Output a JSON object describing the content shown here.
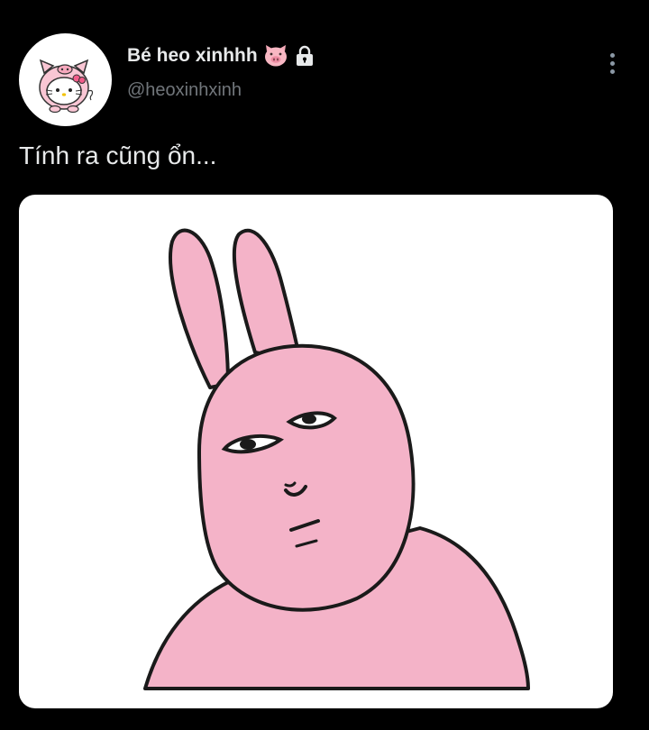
{
  "tweet": {
    "display_name": "Bé heo xinhhh",
    "handle": "@heoxinhxinh",
    "text": "Tính ra cũng ổn...",
    "badges": [
      "pig-face-emoji",
      "lock-icon"
    ]
  },
  "media": {
    "icon": "pink-rabbit-meme-image"
  },
  "colors": {
    "background": "#000000",
    "text": "#e7e9ea",
    "secondary_text": "#71767b",
    "rabbit_pink": "#f4b3c8"
  }
}
